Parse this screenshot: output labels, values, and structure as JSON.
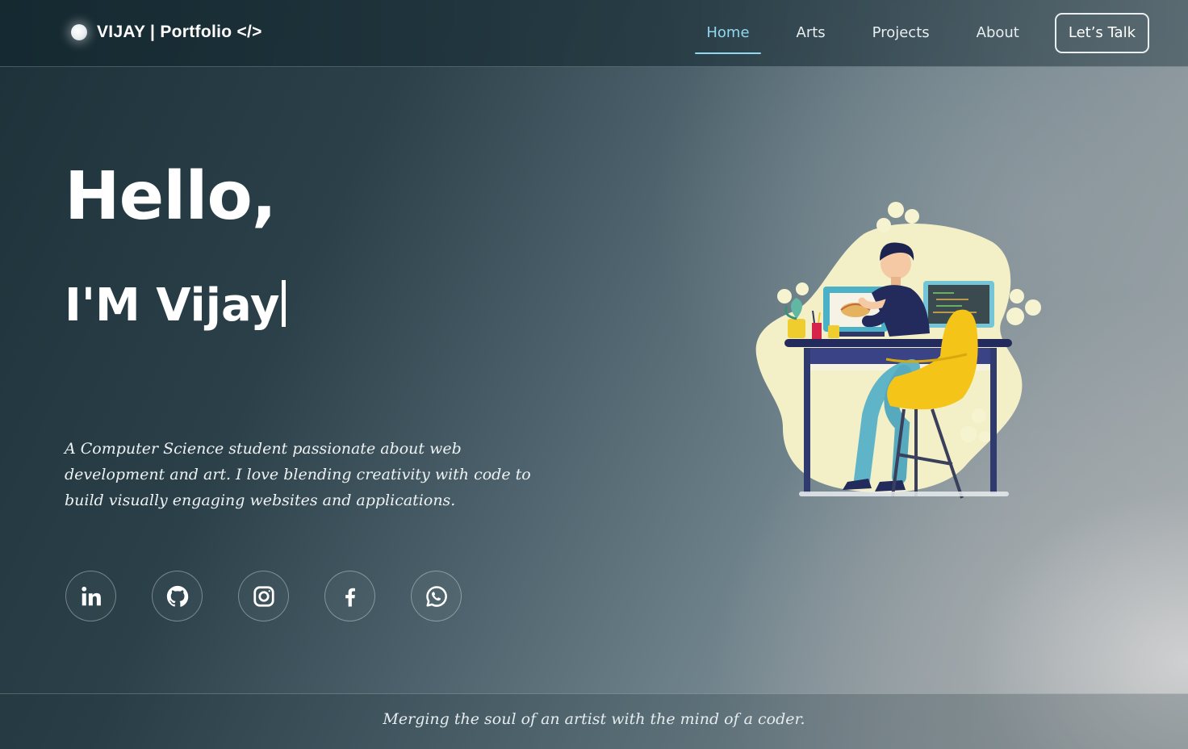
{
  "brand": {
    "name": "VIJAY | Portfolio </>"
  },
  "nav": {
    "links": [
      {
        "label": "Home",
        "active": true
      },
      {
        "label": "Arts",
        "active": false
      },
      {
        "label": "Projects",
        "active": false
      },
      {
        "label": "About",
        "active": false
      }
    ],
    "cta_label": "Let’s Talk"
  },
  "hero": {
    "greeting": "Hello,",
    "name_line": "I'M Vijay",
    "description": "A Computer Science student passionate about web development and art. I love blending creativity with code to build visually engaging websites and applications."
  },
  "socials": [
    {
      "icon": "linkedin-icon"
    },
    {
      "icon": "github-icon"
    },
    {
      "icon": "instagram-icon"
    },
    {
      "icon": "facebook-icon"
    },
    {
      "icon": "whatsapp-icon"
    }
  ],
  "footer": {
    "tagline": "Merging the soul of an artist with the mind of a coder."
  },
  "colors": {
    "accent": "#8fd8ef",
    "blob": "#f3f0c8",
    "chair": "#f4c418",
    "shirt": "#232a5c"
  }
}
